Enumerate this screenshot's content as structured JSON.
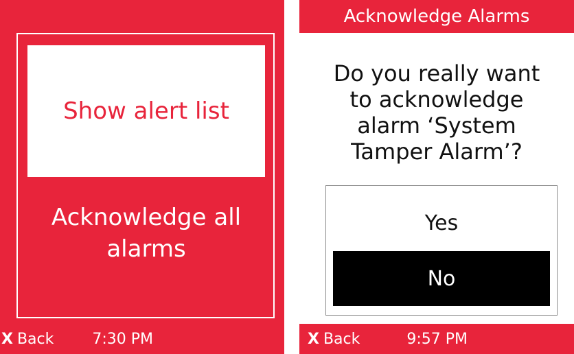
{
  "colors": {
    "accent_red": "#e8243b",
    "selected_black": "#000000",
    "white": "#ffffff"
  },
  "left_screen": {
    "menu": [
      {
        "label": "Show alert list",
        "selected": true
      },
      {
        "label": "Acknowledge all alarms",
        "selected": false
      }
    ],
    "footer": {
      "back_icon": "x-icon",
      "back_icon_glyph": "X",
      "back_label": "Back",
      "time": "7:30 PM"
    }
  },
  "right_screen": {
    "title": "Acknowledge Alarms",
    "question": "Do you really want\nto acknowledge\nalarm ‘System\nTamper Alarm’?",
    "options": [
      {
        "label": "Yes",
        "selected": false
      },
      {
        "label": "No",
        "selected": true
      }
    ],
    "footer": {
      "back_icon": "x-icon",
      "back_icon_glyph": "X",
      "back_label": "Back",
      "time": "9:57 PM"
    }
  }
}
